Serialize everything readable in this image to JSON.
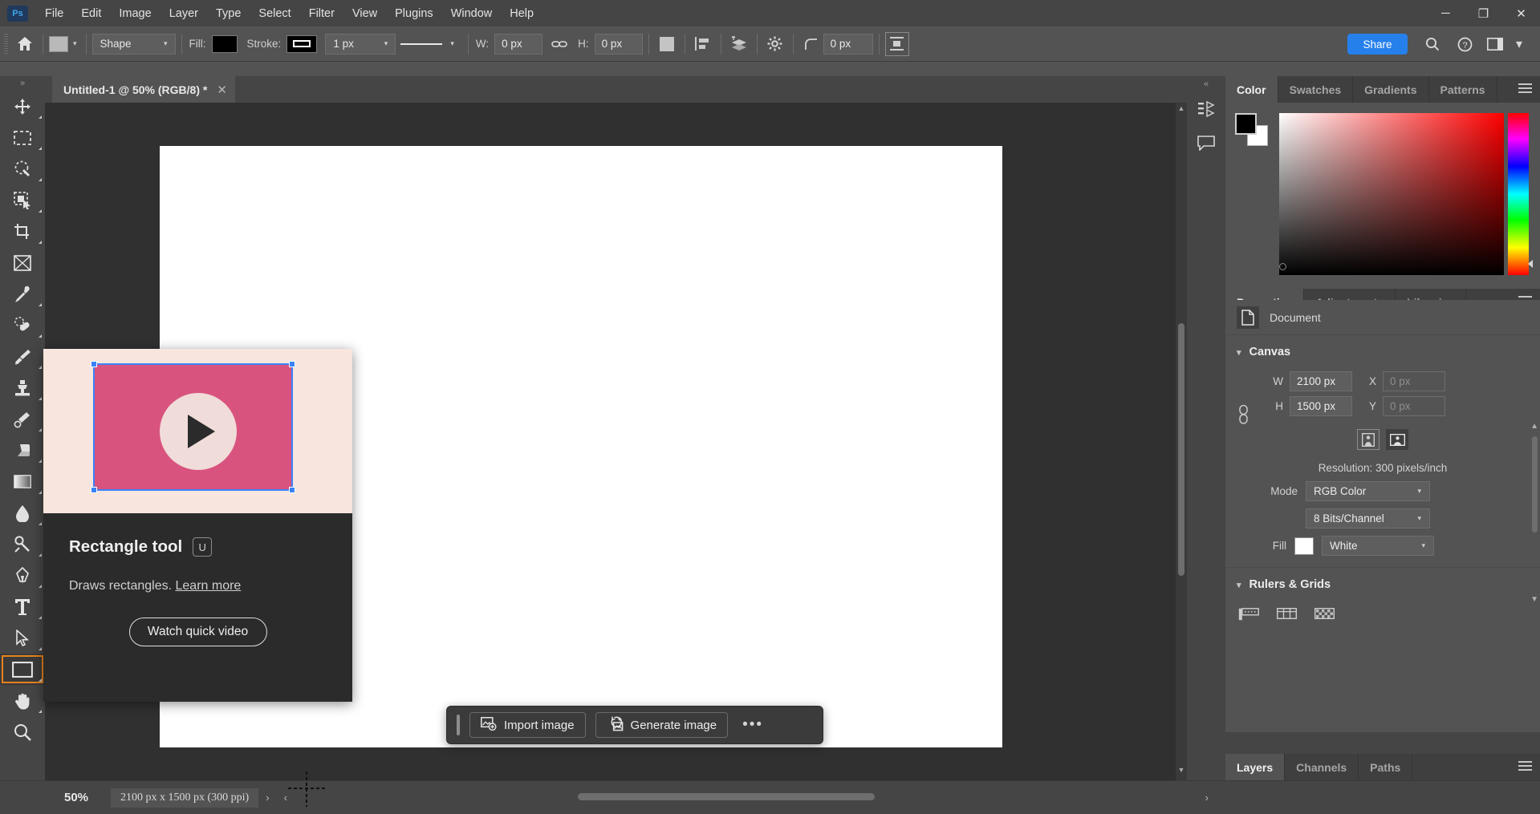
{
  "app": {
    "logo": "Ps"
  },
  "menubar": {
    "items": [
      "File",
      "Edit",
      "Image",
      "Layer",
      "Type",
      "Select",
      "Filter",
      "View",
      "Plugins",
      "Window",
      "Help"
    ],
    "window_controls": {
      "minimize": "─",
      "maximize": "❐",
      "close": "✕"
    }
  },
  "options_bar": {
    "home_icon": "home-icon",
    "shape_preview_icon": "shape-preview-icon",
    "mode": "Shape",
    "fill_label": "Fill:",
    "fill_color": "#000000",
    "stroke_label": "Stroke:",
    "stroke_color": "#000000",
    "stroke_width": "1 px",
    "stroke_style_icon": "solid-line-icon",
    "w_label": "W:",
    "w_value": "0 px",
    "link_icon": "link-icon",
    "h_label": "H:",
    "h_value": "0 px",
    "path_ops_icon": "path-operations-icon",
    "path_align_icon": "path-alignment-icon",
    "path_arrange_icon": "path-arrangement-icon",
    "gear_icon": "gear-icon",
    "radius_icon": "corner-radius-icon",
    "radius_value": "0 px",
    "align_edges_icon": "align-edges-icon",
    "share_label": "Share",
    "search_icon": "search-icon",
    "help_icon": "help-icon",
    "workspace_icon": "workspace-icon",
    "overflow_icon": "chevron-down-icon"
  },
  "toolbar": {
    "expand_icon": "expand-toolbar-icon",
    "tools": [
      {
        "name": "move-tool",
        "icon": "move-icon"
      },
      {
        "name": "rectangular-marquee-tool",
        "icon": "marquee-icon"
      },
      {
        "name": "lasso-tool",
        "icon": "lasso-icon"
      },
      {
        "name": "object-selection-tool",
        "icon": "object-selection-icon"
      },
      {
        "name": "crop-tool",
        "icon": "crop-icon"
      },
      {
        "name": "frame-tool",
        "icon": "frame-icon"
      },
      {
        "name": "eyedropper-tool",
        "icon": "eyedropper-icon"
      },
      {
        "name": "spot-healing-brush-tool",
        "icon": "healing-brush-icon"
      },
      {
        "name": "brush-tool",
        "icon": "brush-icon"
      },
      {
        "name": "clone-stamp-tool",
        "icon": "clone-stamp-icon"
      },
      {
        "name": "history-brush-tool",
        "icon": "history-brush-icon"
      },
      {
        "name": "eraser-tool",
        "icon": "eraser-icon"
      },
      {
        "name": "gradient-tool",
        "icon": "gradient-icon"
      },
      {
        "name": "blur-tool",
        "icon": "blur-drop-icon"
      },
      {
        "name": "dodge-tool",
        "icon": "dodge-icon"
      },
      {
        "name": "pen-tool",
        "icon": "pen-icon"
      },
      {
        "name": "type-tool",
        "icon": "type-icon"
      },
      {
        "name": "path-selection-tool",
        "icon": "path-selection-icon"
      },
      {
        "name": "rectangle-tool",
        "icon": "rectangle-icon"
      },
      {
        "name": "hand-tool",
        "icon": "hand-icon"
      },
      {
        "name": "zoom-tool",
        "icon": "zoom-icon"
      }
    ]
  },
  "document_tab": {
    "title": "Untitled-1 @ 50% (RGB/8) *",
    "close_icon": "close-icon"
  },
  "tooltip_card": {
    "title": "Rectangle tool",
    "shortcut": "U",
    "description": "Draws rectangles.",
    "link": "Learn more",
    "button": "Watch quick video",
    "play_icon": "play-icon"
  },
  "context_taskbar": {
    "grip_icon": "drag-handle-icon",
    "import_label": "Import image",
    "import_icon": "import-image-icon",
    "generate_label": "Generate image",
    "generate_icon": "generate-image-icon",
    "more_label": "•••"
  },
  "status_bar": {
    "zoom": "50%",
    "doc_info": "2100 px x 1500 px (300 ppi)",
    "next_arrow": "›",
    "prev_arrow": "‹"
  },
  "rail": {
    "history_icon": "history-icon",
    "comments_icon": "comments-icon",
    "collapse_icon": "collapse-panels-icon"
  },
  "color_panel": {
    "tabs": [
      "Color",
      "Swatches",
      "Gradients",
      "Patterns"
    ],
    "active_tab": "Color",
    "menu_icon": "panel-menu-icon",
    "foreground_color": "#000000",
    "background_color": "#ffffff",
    "ramp_base_hue": "#ff0000"
  },
  "properties_panel": {
    "tabs": [
      "Properties",
      "Adjustments",
      "Libraries"
    ],
    "active_tab": "Properties",
    "menu_icon": "panel-menu-icon",
    "doc_row_label": "Document",
    "doc_icon": "document-icon",
    "canvas": {
      "title": "Canvas",
      "link_icon": "link-dimensions-icon",
      "w_label": "W",
      "w_value": "2100 px",
      "x_label": "X",
      "x_value": "0 px",
      "h_label": "H",
      "h_value": "1500 px",
      "y_label": "Y",
      "y_value": "0 px",
      "portrait_icon": "portrait-orientation-icon",
      "landscape_icon": "landscape-orientation-icon",
      "resolution": "Resolution: 300 pixels/inch",
      "mode_label": "Mode",
      "mode_value": "RGB Color",
      "depth_value": "8 Bits/Channel",
      "fill_label": "Fill",
      "fill_color": "#ffffff",
      "fill_value": "White"
    },
    "rulers_grids": {
      "title": "Rulers & Grids",
      "rulers_icon": "rulers-icon",
      "guides_icon": "guides-icon",
      "grid_icon": "grid-icon"
    }
  },
  "layers_panel": {
    "tabs": [
      "Layers",
      "Channels",
      "Paths"
    ],
    "active_tab": "Layers",
    "menu_icon": "panel-menu-icon"
  },
  "colors": {
    "accent_blue": "#2680eb",
    "selected_orange": "#e8821e",
    "panel_bg": "#535353",
    "chrome_bg": "#454545",
    "canvas_bg": "#303030",
    "tip_card_bg": "#2b2b2b",
    "tip_image_bg": "#f8e5de",
    "tip_rect_pink": "#d9537f"
  }
}
